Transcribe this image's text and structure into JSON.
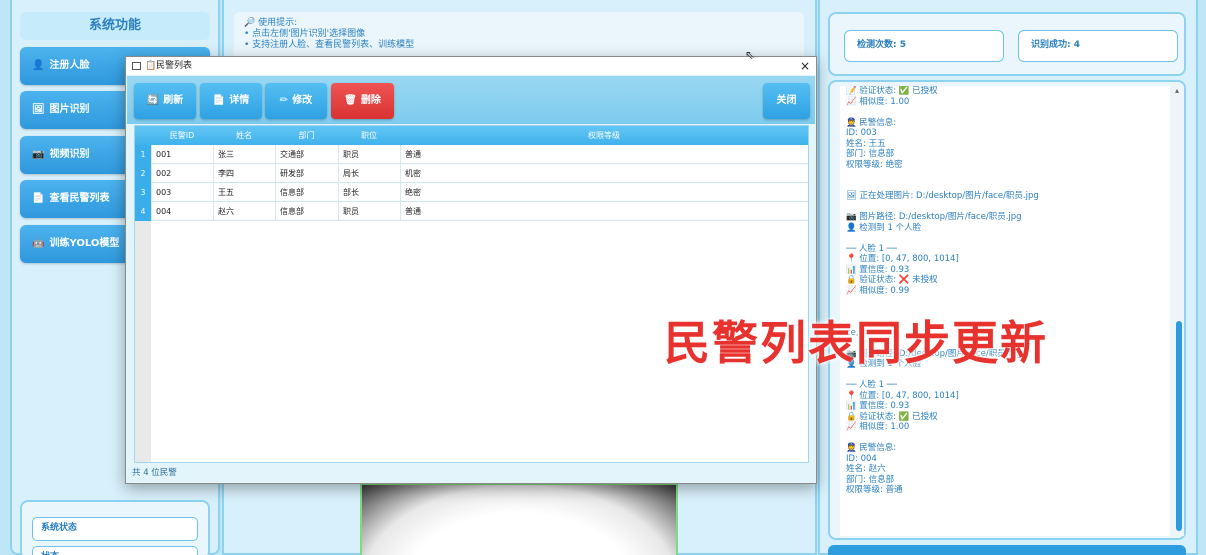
{
  "left": {
    "title": "系统功能",
    "nav": [
      {
        "icon": "👤",
        "label": "注册人脸"
      },
      {
        "icon": "🖼",
        "label": "图片识别"
      },
      {
        "icon": "📷",
        "label": "视频识别"
      },
      {
        "icon": "📄",
        "label": "查看民警列表"
      },
      {
        "icon": "🤖",
        "label": "训练YOLO模型"
      }
    ],
    "status": [
      "系统状态",
      "状态"
    ]
  },
  "tips": {
    "title": "🔎 使用提示:",
    "lines": [
      "• 点击左侧'图片识别'选择图像",
      "• 支持注册人脸、查看民警列表、训练模型"
    ]
  },
  "stats": {
    "detect_count": "检测次数: 5",
    "recognize_success": "识别成功: 4"
  },
  "log": [
    "📝 验证状态: ✅ 已授权",
    "📈 相似度: 1.00",
    "",
    "👮 民警信息:",
    "   ID: 003",
    "   姓名: 王五",
    "   部门: 信息部",
    "   权限等级: 绝密",
    "",
    "",
    "🖼 正在处理图片: D:/desktop/图片/face/职员.jpg",
    "",
    "📷 图片路径: D:/desktop/图片/face/职员.jpg",
    "👤 检测到 1 个人脸",
    "",
    "── 人脸 1 ──",
    "📍 位置: [0, 47, 800, 1014]",
    "📊 置信度: 0.93",
    "🔒 验证状态: ❌ 未授权",
    "📈 相似度: 0.99",
    "",
    "",
    "",
    "ce,",
    "",
    "📷 图片路径: D:/desktop/图片/face/职员.jpg",
    "👤 检测到 1 个人脸",
    "",
    "── 人脸 1 ──",
    "📍 位置: [0, 47, 800, 1014]",
    "📊 置信度: 0.93",
    "🔒 验证状态: ✅ 已授权",
    "📈 相似度: 1.00",
    "",
    "👮 民警信息:",
    "   ID: 004",
    "   姓名: 赵六",
    "   部门: 信息部",
    "   权限等级: 普通"
  ],
  "caption": "民警列表同步更新",
  "dialog": {
    "title": "民警列表",
    "close_glyph": "×",
    "buttons": {
      "refresh": {
        "icon": "🔄",
        "label": "刷新"
      },
      "details": {
        "icon": "📄",
        "label": "详情"
      },
      "edit": {
        "icon": "✏",
        "label": "修改"
      },
      "delete": {
        "icon": "🗑",
        "label": "删除"
      },
      "close": {
        "label": "关闭"
      }
    },
    "columns": [
      "民警ID",
      "姓名",
      "部门",
      "职位",
      "权限等级"
    ],
    "rows": [
      {
        "idx": "1",
        "cells": [
          "001",
          "张三",
          "交通部",
          "职员",
          "普通"
        ]
      },
      {
        "idx": "2",
        "cells": [
          "002",
          "李四",
          "研发部",
          "局长",
          "机密"
        ]
      },
      {
        "idx": "3",
        "cells": [
          "003",
          "王五",
          "信息部",
          "部长",
          "绝密"
        ]
      },
      {
        "idx": "4",
        "cells": [
          "004",
          "赵六",
          "信息部",
          "职员",
          "普通"
        ]
      }
    ],
    "footer": "共 4 位民警"
  },
  "colors": {
    "accent": "#2f98dd",
    "danger": "#d93232",
    "caption": "#e8322e"
  }
}
